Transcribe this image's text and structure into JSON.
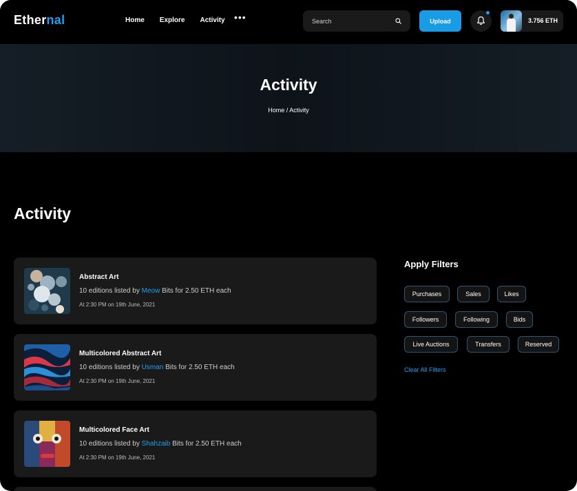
{
  "header": {
    "logo_part1": "Ether",
    "logo_part2": "nal",
    "nav": [
      "Home",
      "Explore",
      "Activity"
    ],
    "more_label": "•••",
    "search_placeholder": "Search",
    "upload_label": "Upload",
    "balance": "3.756 ETH"
  },
  "hero": {
    "title": "Activity",
    "breadcrumb": "Home / Activity"
  },
  "page_title": "Activity",
  "activities": [
    {
      "title": "Abstract Art",
      "desc_prefix": "10 editions listed by ",
      "user": "Meow",
      "desc_suffix": " Bits for 2.50 ETH each",
      "time": "At 2:30 PM on 19th June, 2021"
    },
    {
      "title": "Multicolored Abstract Art",
      "desc_prefix": "10 editions listed by ",
      "user": "Usman",
      "desc_suffix": " Bits for 2.50 ETH each",
      "time": "At 2:30 PM on 19th June, 2021"
    },
    {
      "title": "Multicolored Face Art",
      "desc_prefix": "10 editions listed by ",
      "user": "Shahzaib",
      "desc_suffix": " Bits for 2.50 ETH each",
      "time": "At 2:30 PM on 19th June, 2021"
    }
  ],
  "filters": {
    "title": "Apply Filters",
    "chips": [
      "Purchases",
      "Sales",
      "Likes",
      "Followers",
      "Following",
      "Bids",
      "Live Auctions",
      "Transfers",
      "Reserved"
    ],
    "clear_label": "Clear All Filters"
  },
  "colors": {
    "accent": "#1DA1F2",
    "background": "#000000",
    "card": "#1a1a1a"
  }
}
